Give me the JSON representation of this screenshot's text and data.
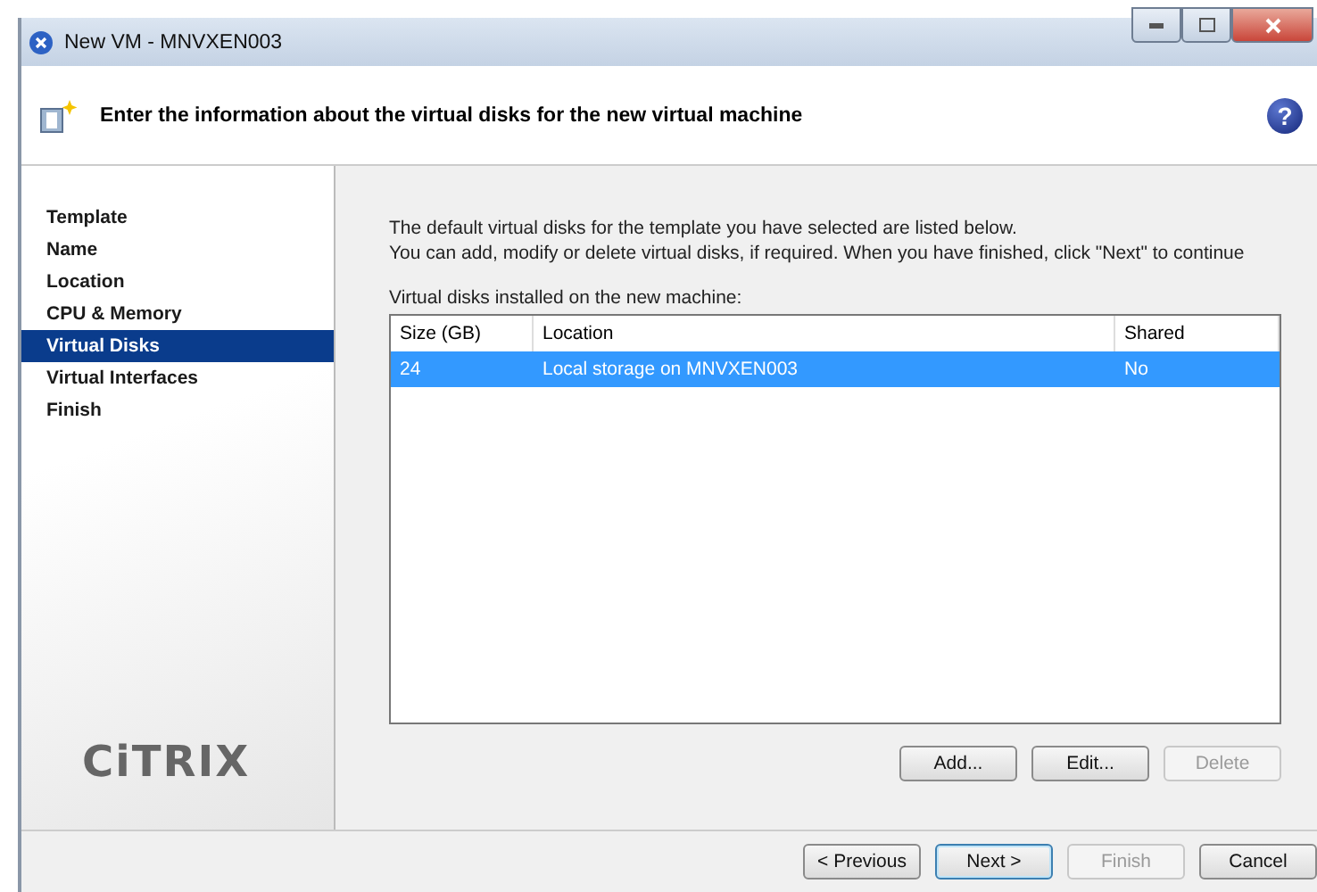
{
  "window": {
    "title": "New VM - MNVXEN003"
  },
  "header": {
    "text": "Enter the information about the virtual disks for the new virtual machine",
    "help": "?"
  },
  "sidebar": {
    "items": [
      {
        "label": "Template",
        "selected": false
      },
      {
        "label": "Name",
        "selected": false
      },
      {
        "label": "Location",
        "selected": false
      },
      {
        "label": "CPU & Memory",
        "selected": false
      },
      {
        "label": "Virtual Disks",
        "selected": true
      },
      {
        "label": "Virtual Interfaces",
        "selected": false
      },
      {
        "label": "Finish",
        "selected": false
      }
    ],
    "logo": "CiTRIX"
  },
  "intro": [
    "The default virtual disks for the template you have selected are listed below.",
    "You can add, modify or delete virtual disks, if required. When you have finished, click \"Next\" to continue"
  ],
  "table": {
    "caption": "Virtual disks installed on the new machine:",
    "columns": [
      "Size (GB)",
      "Location",
      "Shared"
    ],
    "rows": [
      {
        "cells": [
          "24",
          "Local storage on MNVXEN003",
          "No"
        ],
        "selected": true
      }
    ]
  },
  "table_buttons": [
    {
      "label": "Add...",
      "disabled": false
    },
    {
      "label": "Edit...",
      "disabled": false
    },
    {
      "label": "Delete",
      "disabled": true
    }
  ],
  "footer_buttons": [
    {
      "label": "< Previous",
      "disabled": false,
      "default": false
    },
    {
      "label": "Next >",
      "disabled": false,
      "default": true
    },
    {
      "label": "Finish",
      "disabled": true,
      "default": false
    },
    {
      "label": "Cancel",
      "disabled": false,
      "default": false
    }
  ]
}
